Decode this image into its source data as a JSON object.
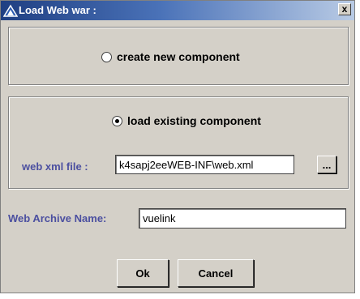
{
  "window": {
    "title": "Load Web war :",
    "close_label": "x"
  },
  "options": {
    "create_label": "create new component",
    "create_selected": false,
    "load_label": "load existing component",
    "load_selected": true
  },
  "web_xml": {
    "label": "web xml file :",
    "value": "k4sapj2eeWEB-INF\\web.xml",
    "browse_label": "..."
  },
  "archive": {
    "label": "Web Archive Name:",
    "value": "vuelink"
  },
  "buttons": {
    "ok": "Ok",
    "cancel": "Cancel"
  },
  "icons": {
    "title": "java-cup-icon"
  }
}
